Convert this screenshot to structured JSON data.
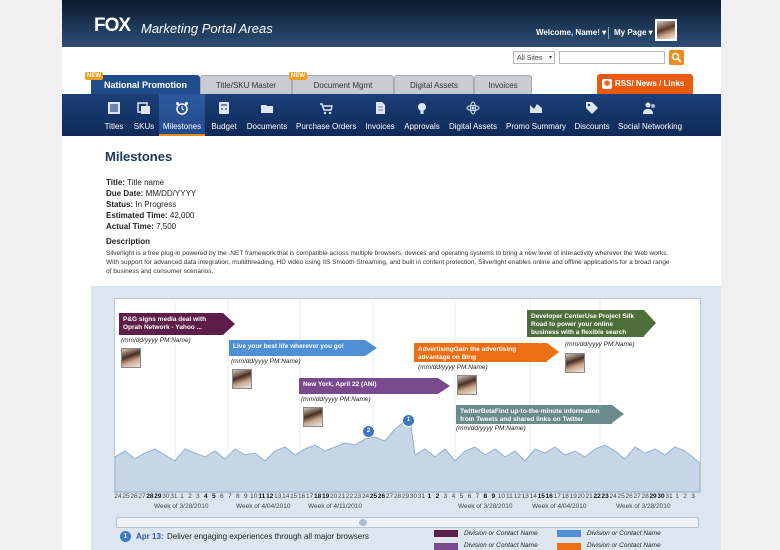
{
  "header": {
    "logo": "FOX",
    "app_title": "Marketing Portal Areas",
    "welcome": "Welcome, Name! ▾",
    "my_page": "My Page ▾"
  },
  "search": {
    "scope": "All Sites",
    "query": ""
  },
  "tabs": [
    {
      "label": "National Promotion",
      "active": true,
      "new": true
    },
    {
      "label": "Title/SKU Master",
      "active": false,
      "new": false
    },
    {
      "label": "Document Mgmt",
      "active": false,
      "new": true
    },
    {
      "label": "Digital Assets",
      "active": false,
      "new": false
    },
    {
      "label": "Invoices",
      "active": false,
      "new": false
    }
  ],
  "new_badge": "NEW",
  "rss_tab": {
    "label": "RSS/ News / Links",
    "icon": "rss-icon"
  },
  "subnav": [
    {
      "label": "Titles",
      "icon": "film-icon"
    },
    {
      "label": "SKUs",
      "icon": "sku-icon"
    },
    {
      "label": "Milestones",
      "icon": "alarm-clock-icon",
      "active": true
    },
    {
      "label": "Budget",
      "icon": "calculator-icon"
    },
    {
      "label": "Documents",
      "icon": "folder-icon"
    },
    {
      "label": "Purchase Orders",
      "icon": "cart-icon"
    },
    {
      "label": "Invoices",
      "icon": "invoice-icon"
    },
    {
      "label": "Approvals",
      "icon": "lightbulb-icon"
    },
    {
      "label": "Digital Assets",
      "icon": "atom-icon"
    },
    {
      "label": "Promo Summary",
      "icon": "summary-icon"
    },
    {
      "label": "Discounts",
      "icon": "tag-icon"
    },
    {
      "label": "Social Networking",
      "icon": "people-icon"
    }
  ],
  "page": {
    "title": "Milestones",
    "fields": [
      {
        "label": "Title:",
        "value": "Title name"
      },
      {
        "label": "Due Date:",
        "value": "MM/DD/YYYY"
      },
      {
        "label": "Status:",
        "value": "In Progress"
      },
      {
        "label": "Estimated Time:",
        "value": "42,000"
      },
      {
        "label": "Actual Time:",
        "value": "7,500"
      }
    ],
    "description_heading": "Description",
    "description": "Silverlight is a free plug-in powered by the .NET framework that is compatible across multiple browsers, devices and operating systems to bring a new level of interactivity wherever the Web works. With support for advanced data integration, multithreading, HD video using IIS Smooth Streaming, and built in content protection, Silverlight enables online and offline applications for a broad range of business and consumer scenarios."
  },
  "timeline": {
    "events": [
      {
        "text": "P&G signs media deal with Oprah Network - Yahoo ...",
        "date": "(mm/dd/yyyy PM:Name)",
        "color": "#5e1e4a"
      },
      {
        "text": "Live your best life wherever you go!",
        "date": "(mm/dd/yyyy PM:Name)",
        "color": "#4f8fd6"
      },
      {
        "text": "New York, April 22 (ANI)",
        "date": "(mm/dd/yyyy PM:Name)",
        "color": "#7a4a8e"
      },
      {
        "text": "AdvertisingGain the advertising advantage on Bing",
        "date": "(mm/dd/yyyy PM:Name)",
        "color": "#ec6f14"
      },
      {
        "text": "TwitterBetaFind up-to-the-minute information from Tweets and shared links on Twitter",
        "date": "(mm/dd/yyyy PM:Name)",
        "color": "#6a8a8c"
      },
      {
        "text": "Developer CenterUse Project Silk Road to power your online business with a flexible search engine",
        "date": "(mm/dd/yyyy PM:Name)",
        "color": "#4e6e3a"
      }
    ],
    "pins": [
      "2",
      "1"
    ],
    "ticks": [
      "24",
      "25",
      "26",
      "27",
      "28",
      "29",
      "30",
      "31",
      "1",
      "2",
      "3",
      "4",
      "5",
      "6",
      "7",
      "8",
      "9",
      "10",
      "11",
      "12",
      "13",
      "14",
      "15",
      "16",
      "17",
      "18",
      "19",
      "20",
      "21",
      "22",
      "23",
      "24",
      "25",
      "26",
      "27",
      "28",
      "29",
      "30",
      "31",
      "1",
      "2",
      "3",
      "4",
      "5",
      "6",
      "7",
      "8",
      "9",
      "10",
      "11",
      "12",
      "13",
      "14",
      "15",
      "16",
      "17",
      "18",
      "19",
      "20",
      "21",
      "22",
      "23",
      "24",
      "25",
      "26",
      "27",
      "28",
      "29",
      "30",
      "31",
      "1",
      "2",
      "3"
    ],
    "bold_ticks": [
      "28",
      "29",
      "4",
      "5",
      "11",
      "12",
      "18",
      "19",
      "28",
      "29",
      "4",
      "5",
      "28",
      "29"
    ],
    "weeks": [
      "Week of 3/28/2010",
      "Week of 4/04/2010",
      "Week of 4/11/2010",
      "Week of 3/28/2010",
      "Week of 4/04/2010",
      "Week of 3/28/2010"
    ]
  },
  "milestone_list": [
    {
      "num": "1",
      "date": "Apr 13:",
      "text": "Deliver engaging experiences through all major browsers"
    }
  ],
  "legend": [
    {
      "label": "Division or Contact Name",
      "color": "#5e1e4a"
    },
    {
      "label": "Division or Contact Name",
      "color": "#4f8fd6"
    },
    {
      "label": "Division or Contact Name",
      "color": "#7a4a8e"
    },
    {
      "label": "Division or Contact Name",
      "color": "#ec6f14"
    }
  ]
}
